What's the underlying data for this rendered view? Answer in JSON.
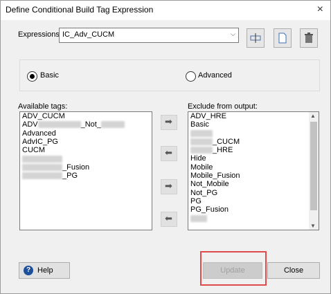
{
  "window": {
    "title": "Define Conditional Build Tag Expression"
  },
  "expressions": {
    "label": "Expressions:",
    "value": "IC_Adv_CUCM"
  },
  "mode": {
    "basic_label": "Basic",
    "advanced_label": "Advanced",
    "selected": "Basic"
  },
  "available": {
    "label": "Available tags:",
    "items": [
      "ADV_CUCM",
      "_Not_",
      "Advanced",
      "AdvIC_PG",
      "CUCM",
      "",
      "_Fusion",
      "_PG"
    ]
  },
  "exclude": {
    "label": "Exclude from output:",
    "items": [
      "ADV_HRE",
      "Basic",
      "",
      "_CUCM",
      "_HRE",
      "Hide",
      "Mobile",
      "Mobile_Fusion",
      "Not_Mobile",
      "Not_PG",
      "PG",
      "PG_Fusion",
      ""
    ]
  },
  "buttons": {
    "help": "Help",
    "update": "Update",
    "close": "Close"
  },
  "icons": {
    "window_close": "×",
    "combo_arrow": "⌵",
    "move_right": "➡",
    "move_left": "⬅",
    "scroll_up": "▲",
    "scroll_down": "▼",
    "help": "?"
  },
  "colors": {
    "highlight": "#e04a4a",
    "accent": "#1c4f9c"
  }
}
